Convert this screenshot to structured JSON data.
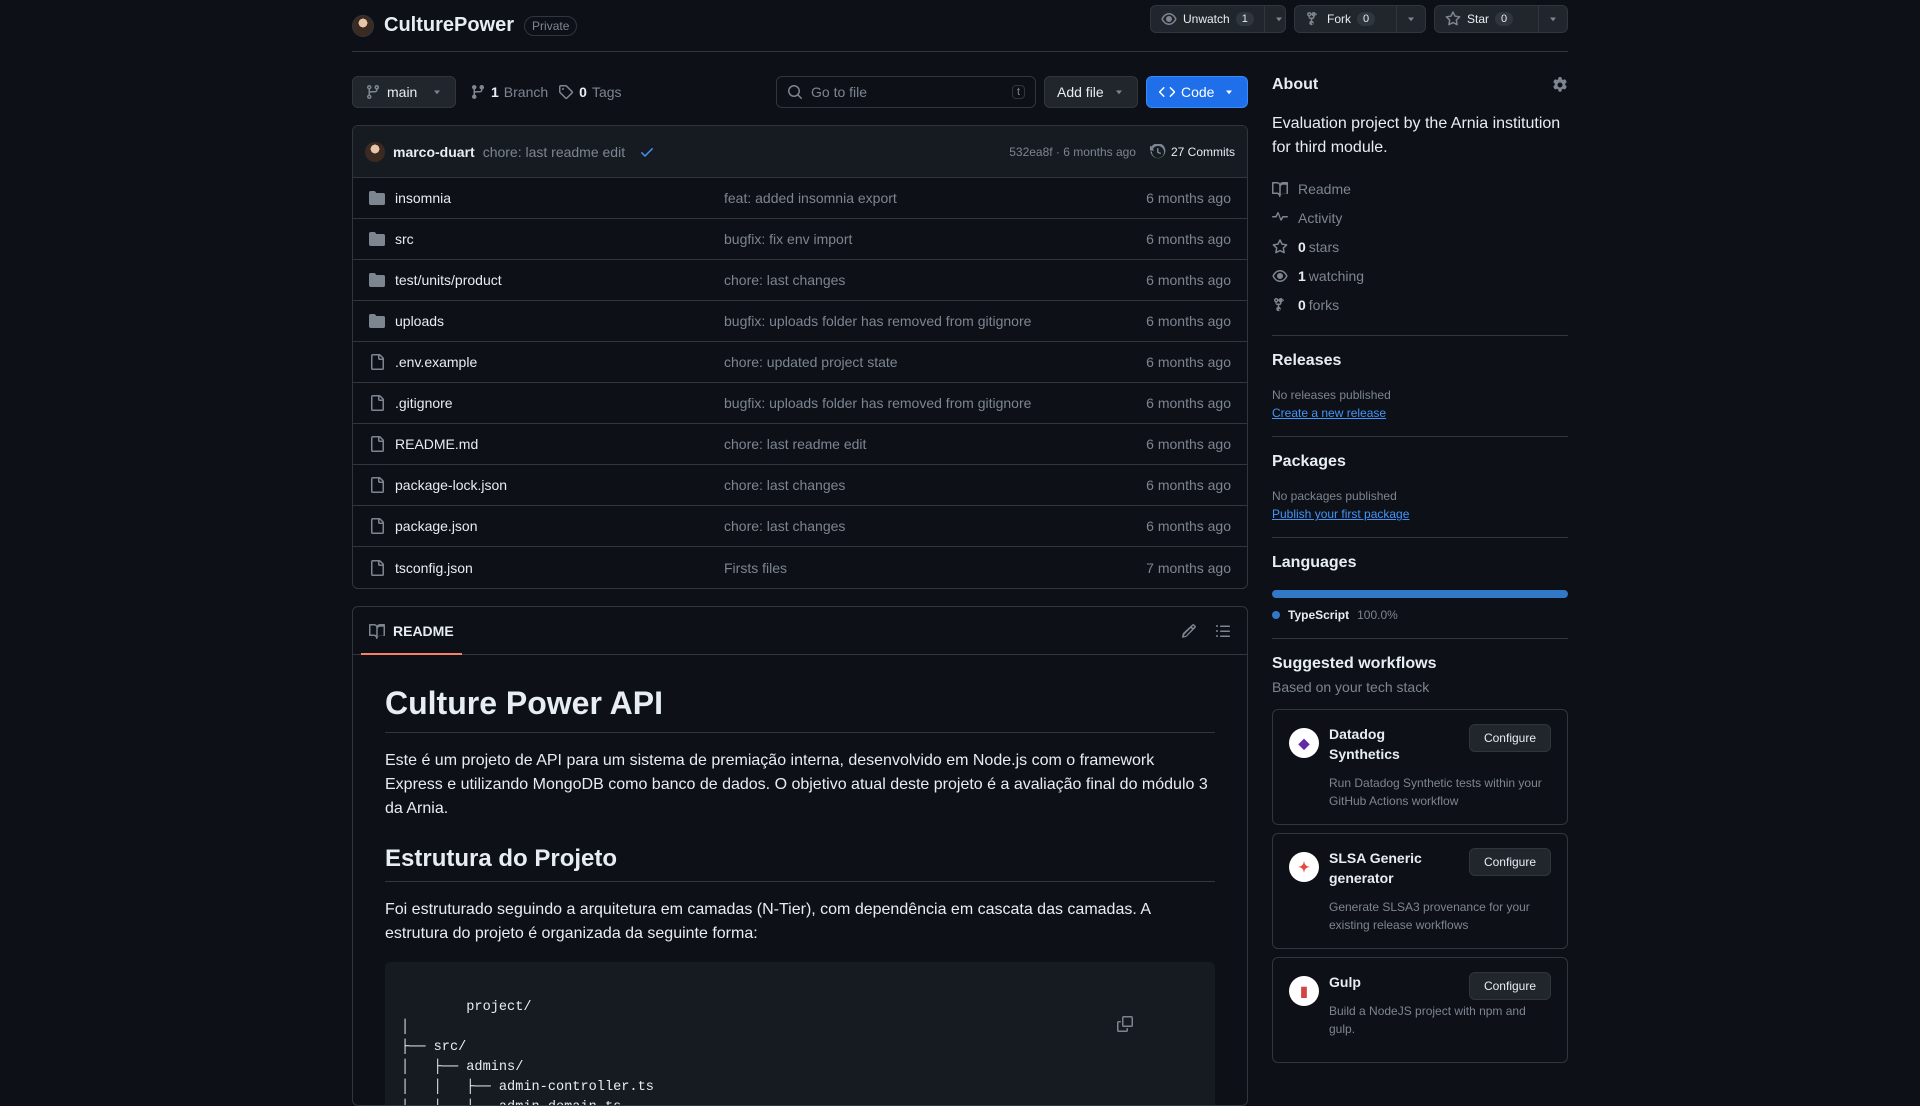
{
  "repo": {
    "name": "CulturePower",
    "visibility": "Private"
  },
  "header_actions": {
    "watch": {
      "label": "Unwatch",
      "count": "1"
    },
    "fork": {
      "label": "Fork",
      "count": "0"
    },
    "star": {
      "label": "Star",
      "count": "0"
    }
  },
  "toolbar": {
    "branch": "main",
    "branches_count": "1",
    "branches_label": "Branch",
    "tags_count": "0",
    "tags_label": "Tags",
    "goto_placeholder": "Go to file",
    "goto_shortcut": "t",
    "add_file": "Add file",
    "code": "Code"
  },
  "latest_commit": {
    "user": "marco-duart",
    "message": "chore: last readme edit",
    "hash_time": "532ea8f · 6 months ago",
    "commits": "27 Commits"
  },
  "files": [
    {
      "name": "insomnia",
      "type": "dir",
      "message": "feat: added insomnia export",
      "date": "6 months ago"
    },
    {
      "name": "src",
      "type": "dir",
      "message": "bugfix: fix env import",
      "date": "6 months ago"
    },
    {
      "name": "test/units/product",
      "type": "dir",
      "message": "chore: last changes",
      "date": "6 months ago"
    },
    {
      "name": "uploads",
      "type": "dir",
      "message": "bugfix: uploads folder has removed from gitignore",
      "date": "6 months ago"
    },
    {
      "name": ".env.example",
      "type": "file",
      "message": "chore: updated project state",
      "date": "6 months ago"
    },
    {
      "name": ".gitignore",
      "type": "file",
      "message": "bugfix: uploads folder has removed from gitignore",
      "date": "6 months ago"
    },
    {
      "name": "README.md",
      "type": "file",
      "message": "chore: last readme edit",
      "date": "6 months ago"
    },
    {
      "name": "package-lock.json",
      "type": "file",
      "message": "chore: last changes",
      "date": "6 months ago"
    },
    {
      "name": "package.json",
      "type": "file",
      "message": "chore: last changes",
      "date": "6 months ago"
    },
    {
      "name": "tsconfig.json",
      "type": "file",
      "message": "Firsts files",
      "date": "7 months ago"
    }
  ],
  "readme": {
    "tab": "README",
    "h1": "Culture Power API",
    "p1": "Este é um projeto de API para um sistema de premiação interna, desenvolvido em Node.js com o framework Express e utilizando MongoDB como banco de dados. O objetivo atual deste projeto é a avaliação final do módulo 3 da Arnia.",
    "h2": "Estrutura do Projeto",
    "p2": "Foi estruturado seguindo a arquitetura em camadas (N-Tier), com dependência em cascata das camadas. A estrutura do projeto é organizada da seguinte forma:",
    "code": "project/\n│\n├── src/\n│   ├── admins/\n│   │   ├── admin-controller.ts\n│   │   ├── admin-domain.ts"
  },
  "about": {
    "title": "About",
    "description": "Evaluation project by the Arnia institution for third module.",
    "readme": "Readme",
    "activity": "Activity",
    "stars_count": "0",
    "stars_label": "stars",
    "watching_count": "1",
    "watching_label": "watching",
    "forks_count": "0",
    "forks_label": "forks"
  },
  "releases": {
    "title": "Releases",
    "empty": "No releases published",
    "link": "Create a new release"
  },
  "packages": {
    "title": "Packages",
    "empty": "No packages published",
    "link": "Publish your first package"
  },
  "languages": {
    "title": "Languages",
    "items": [
      {
        "name": "TypeScript",
        "percent": "100.0%",
        "fraction": 1.0,
        "color": "#3178c6"
      }
    ]
  },
  "workflows": {
    "title": "Suggested workflows",
    "subtitle": "Based on your tech stack",
    "items": [
      {
        "title": "Datadog Synthetics",
        "desc": "Run Datadog Synthetic tests within your GitHub Actions workflow",
        "button": "Configure"
      },
      {
        "title": "SLSA Generic generator",
        "desc": "Generate SLSA3 provenance for your existing release workflows",
        "button": "Configure"
      },
      {
        "title": "Gulp",
        "desc": "Build a NodeJS project with npm and gulp.",
        "button": "Configure"
      }
    ]
  }
}
